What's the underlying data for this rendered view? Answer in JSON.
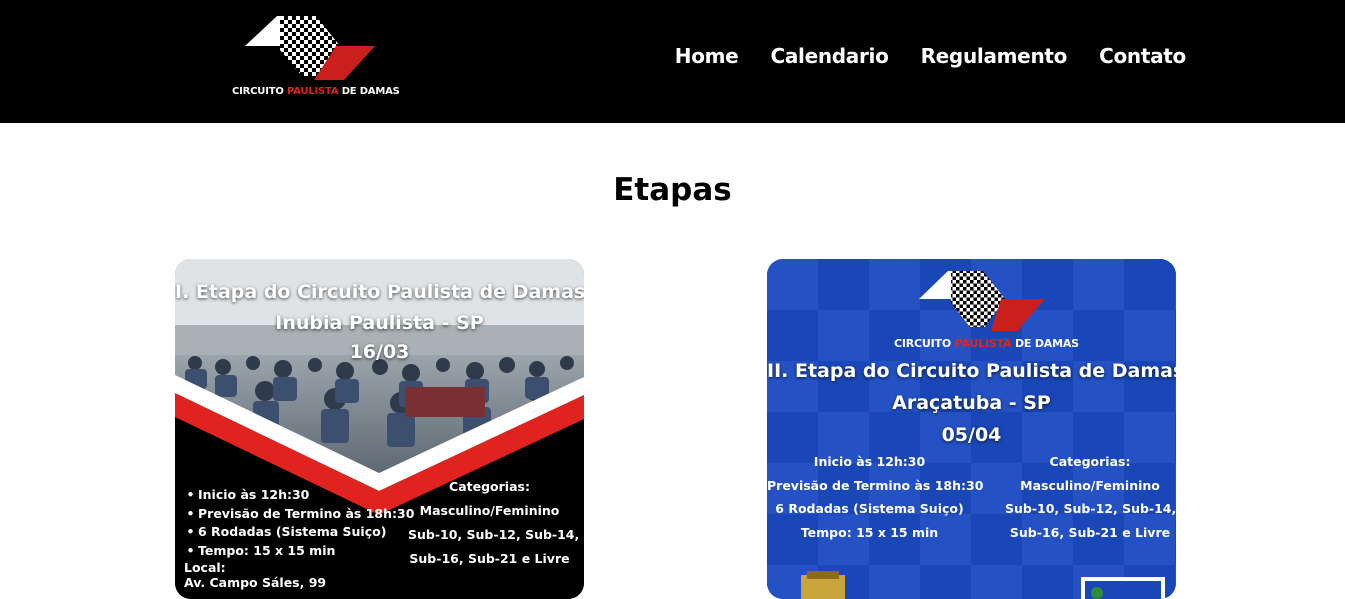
{
  "header": {
    "logo": {
      "text_before": "CIRCUITO ",
      "text_highlight": "PAULISTA",
      "text_after": " DE DAMAS"
    },
    "nav": [
      "Home",
      "Calendario",
      "Regulamento",
      "Contato"
    ]
  },
  "main": {
    "title": "Etapas",
    "cards": [
      {
        "title_lines": [
          "I. Etapa do Circuito Paulista de Damas",
          "Inubia Paulista - SP",
          "16/03"
        ],
        "info": [
          "Inicio às 12h:30",
          "Previsão de Termino às 18h:30",
          "6 Rodadas (Sistema Suiço)",
          "Tempo: 15 x 15 min"
        ],
        "local_label": "Local:",
        "local_value": "Av. Campo Sáles, 99",
        "categories": [
          "Categorias:",
          "Masculino/Feminino",
          "Sub-10,  Sub-12, Sub-14,",
          "Sub-16,  Sub-21 e Livre"
        ]
      },
      {
        "logo": {
          "text_before": "CIRCUITO ",
          "text_highlight": "PAULISTA",
          "text_after": " DE DAMAS"
        },
        "title_lines": [
          "II. Etapa do Circuito Paulista de Damas",
          "Araçatuba - SP",
          "05/04"
        ],
        "info": [
          "Inicio às 12h:30",
          "Previsão de Termino às 18h:30",
          "6 Rodadas (Sistema Suiço)",
          "Tempo: 15 x 15 min"
        ],
        "categories": [
          "Categorias:",
          "Masculino/Feminino",
          "Sub-10,  Sub-12, Sub-14,",
          "Sub-16,  Sub-21 e Livre"
        ]
      }
    ]
  },
  "colors": {
    "header_bg": "#000000",
    "accent_red": "#e0231f",
    "card2_blue": "#1a47b8",
    "text_white": "#ffffff"
  }
}
